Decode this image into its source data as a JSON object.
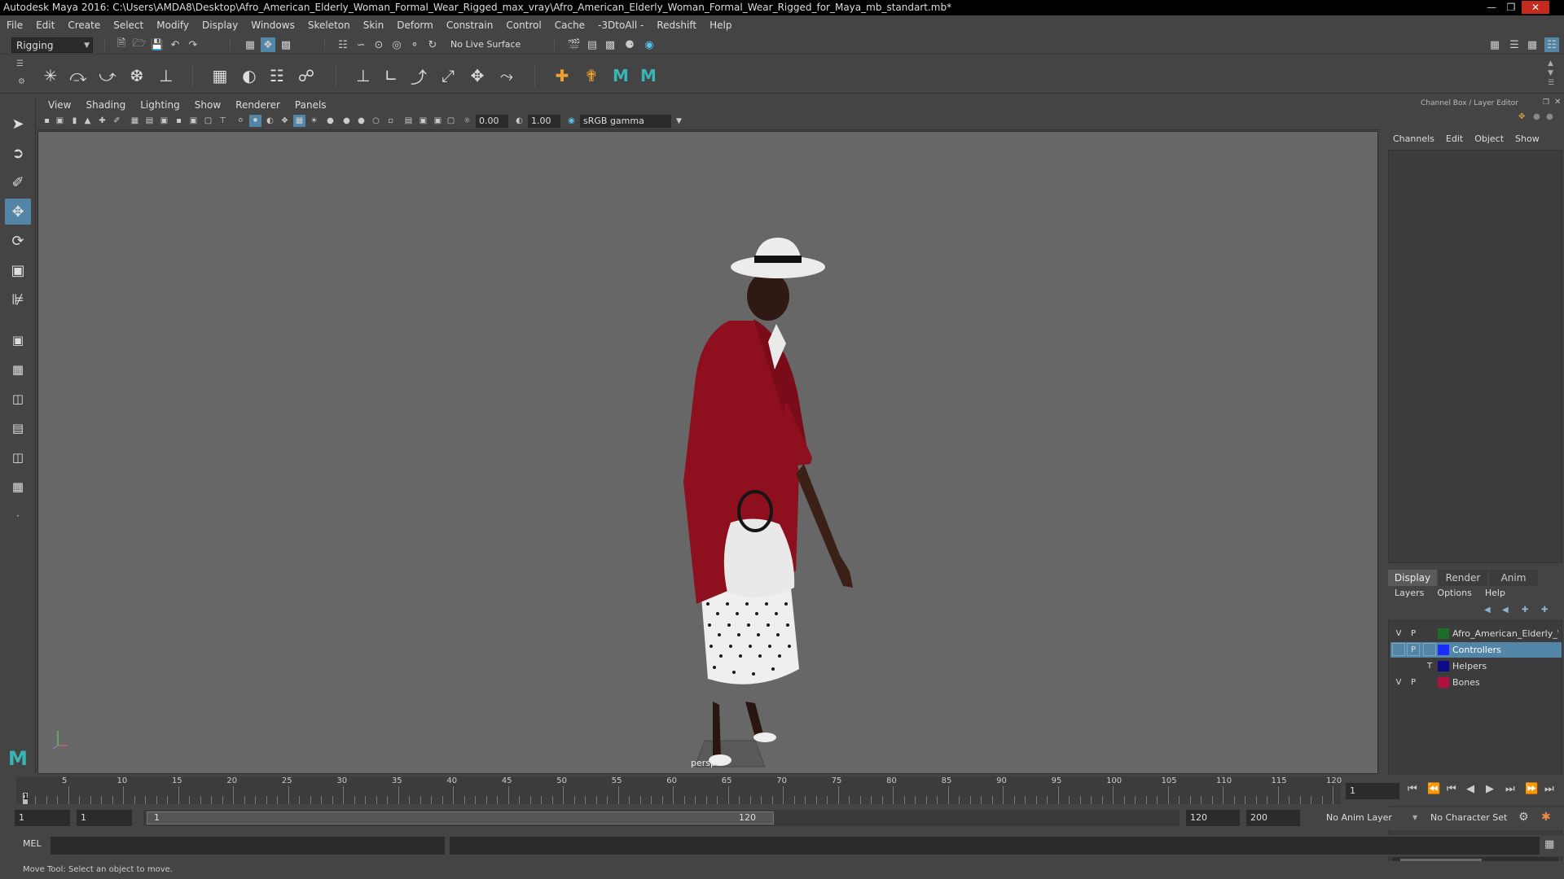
{
  "window": {
    "title": "Autodesk Maya 2016: C:\\Users\\AMDA8\\Desktop\\Afro_American_Elderly_Woman_Formal_Wear_Rigged_max_vray\\Afro_American_Elderly_Woman_Formal_Wear_Rigged_for_Maya_mb_standart.mb*"
  },
  "menubar": [
    "File",
    "Edit",
    "Create",
    "Select",
    "Modify",
    "Display",
    "Windows",
    "Skeleton",
    "Skin",
    "Deform",
    "Constrain",
    "Control",
    "Cache",
    "-3DtoAll -",
    "Redshift",
    "Help"
  ],
  "statusline": {
    "menuset": "Rigging",
    "live_surface": "No Live Surface"
  },
  "viewport": {
    "menu": [
      "View",
      "Shading",
      "Lighting",
      "Show",
      "Renderer",
      "Panels"
    ],
    "exposure": "0.00",
    "gamma": "1.00",
    "color_space": "sRGB gamma",
    "camera": "persp"
  },
  "channel_box": {
    "title": "Channel Box / Layer Editor",
    "menu": [
      "Channels",
      "Edit",
      "Object",
      "Show"
    ]
  },
  "layer_editor": {
    "tabs": [
      "Display",
      "Render",
      "Anim"
    ],
    "active_tab": "Display",
    "menu": [
      "Layers",
      "Options",
      "Help"
    ],
    "layers": [
      {
        "v": "V",
        "p": "P",
        "name": "Afro_American_Elderly_W",
        "color": "#1a6e2a",
        "selected": false
      },
      {
        "v": "",
        "p": "P",
        "name": "Controllers",
        "color": "#1a2cff",
        "selected": true
      },
      {
        "v": "",
        "p": "T",
        "name": "Helpers",
        "color": "#0a0a8a",
        "selected": false
      },
      {
        "v": "V",
        "p": "P",
        "name": "Bones",
        "color": "#b0103a",
        "selected": false
      }
    ]
  },
  "timeline": {
    "ticks": [
      "5",
      "10",
      "15",
      "20",
      "25",
      "30",
      "35",
      "40",
      "45",
      "50",
      "55",
      "60",
      "65",
      "70",
      "75",
      "80",
      "85",
      "90",
      "95",
      "100",
      "105",
      "110",
      "115",
      "120"
    ],
    "current_frame_marker": "1",
    "current_frame": "1"
  },
  "range": {
    "start": "1",
    "playback_start": "1",
    "slider_start": "1",
    "slider_end": "120",
    "playback_end": "120",
    "end": "200",
    "anim_layer": "No Anim Layer",
    "character_set": "No Character Set"
  },
  "command": {
    "language": "MEL"
  },
  "help_line": "Move Tool: Select an object to move.",
  "colors": {
    "accent": "#5285a6",
    "viewport_bg": "#676767",
    "panel_bg": "#444444"
  }
}
